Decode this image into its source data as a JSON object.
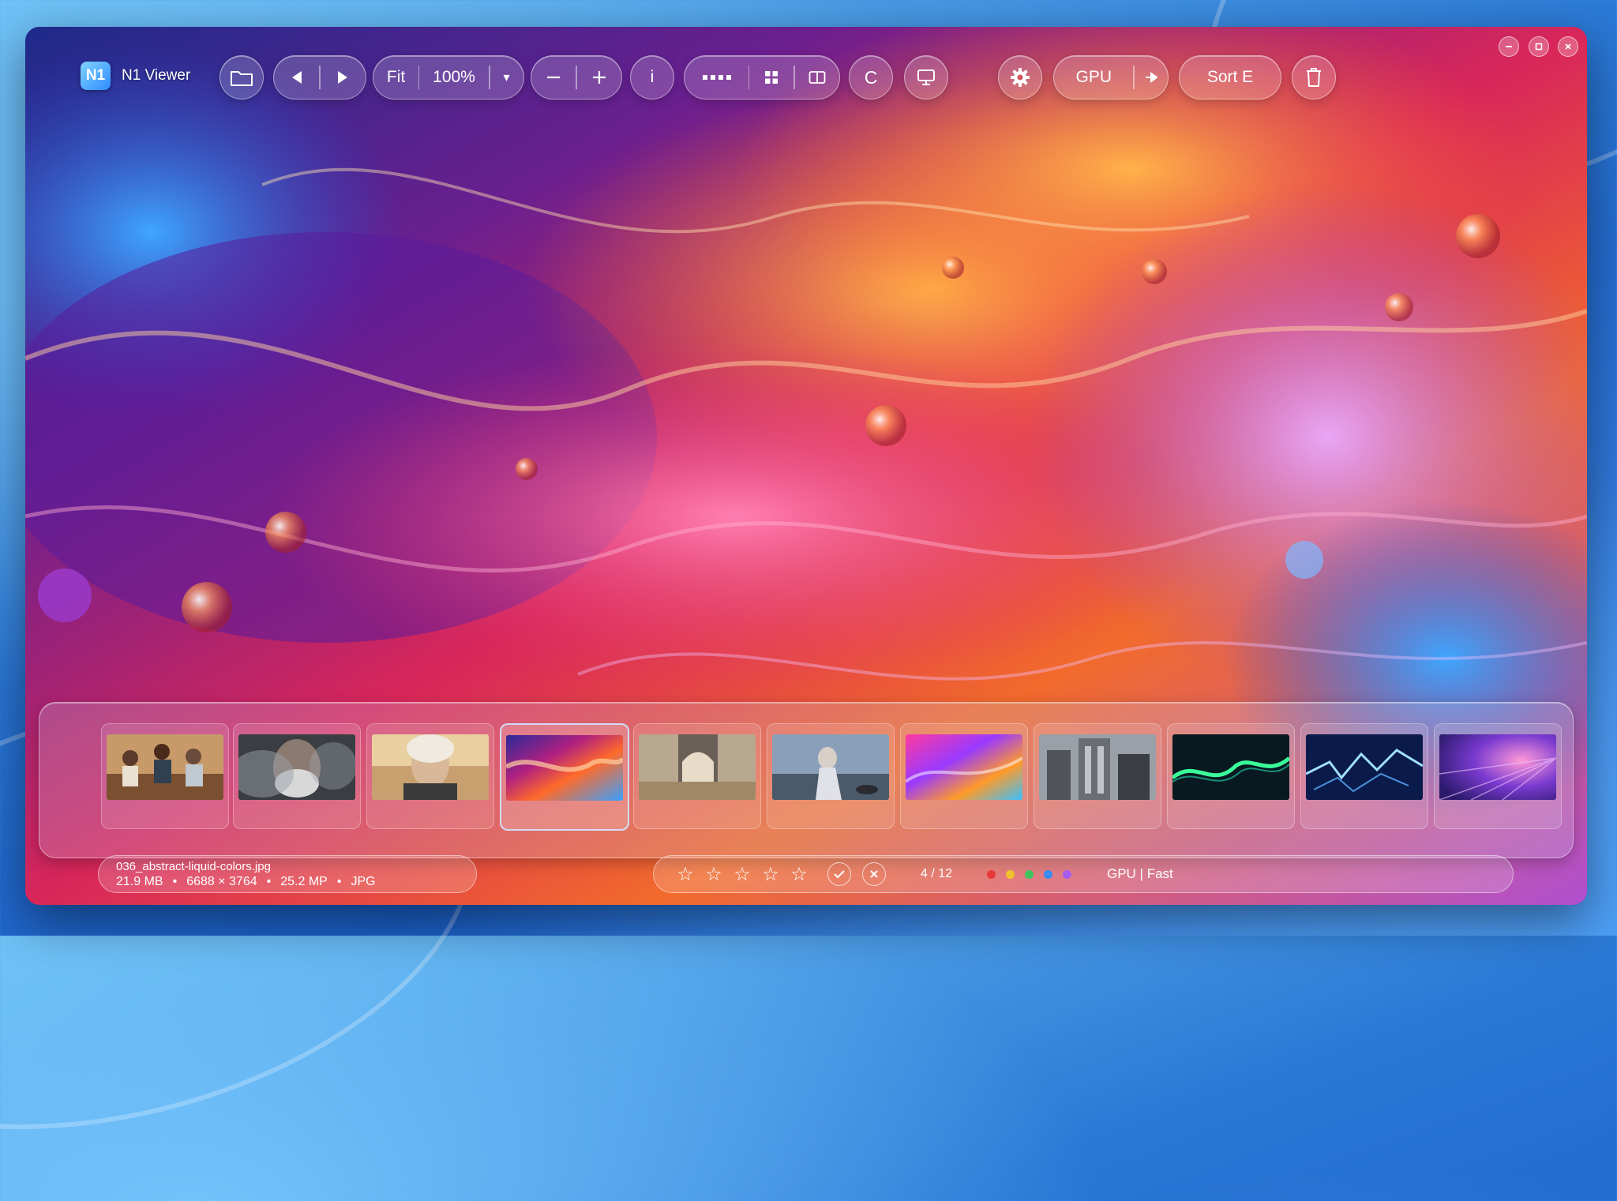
{
  "app": {
    "logo_text": "N1",
    "title": "N1 Viewer"
  },
  "toolbar": {
    "fit_label": "Fit",
    "zoom_value": "100%",
    "zoom_dropdown_glyph": "▾",
    "info_label": "i",
    "c_label": "C",
    "gpu_label": "GPU",
    "sort_label": "Sort E"
  },
  "icons": [
    "open-folder-icon",
    "prev-arrow-icon",
    "next-arrow-icon",
    "zoom-out-icon",
    "zoom-in-icon",
    "filmstrip-icon",
    "grid-icon",
    "compare-icon",
    "slideshow-icon",
    "gear-icon",
    "gpu-arrow-icon",
    "trash-icon",
    "minimize-icon",
    "maximize-icon",
    "close-icon",
    "check-icon",
    "reject-icon"
  ],
  "filmstrip": {
    "selected_index": 3,
    "thumbnails": [
      {
        "subject": "family-kitchen"
      },
      {
        "subject": "man-smoke-portrait"
      },
      {
        "subject": "elderly-woman-portrait"
      },
      {
        "subject": "abstract-liquid-colors"
      },
      {
        "subject": "interior-arch-room"
      },
      {
        "subject": "woman-coast-seascape"
      },
      {
        "subject": "neon-abstract-waves"
      },
      {
        "subject": "brutalist-architecture"
      },
      {
        "subject": "green-light-wave"
      },
      {
        "subject": "blue-lightning-particles"
      },
      {
        "subject": "purple-light-rays"
      }
    ]
  },
  "file": {
    "name": "036_abstract-liquid-colors.jpg",
    "size": "21.9 MB",
    "dimensions": "6688 × 3764",
    "megapixels": "25.2 MP",
    "format": "JPG",
    "sep": "•"
  },
  "status": {
    "stars": [
      "☆",
      "☆",
      "☆",
      "☆",
      "☆"
    ],
    "rating": 0,
    "position": "4 / 12",
    "color_labels": [
      "#e83a3a",
      "#f2c12e",
      "#3ec45a",
      "#3b8cf0",
      "#a65cf0"
    ],
    "render_mode": "GPU | Fast"
  }
}
